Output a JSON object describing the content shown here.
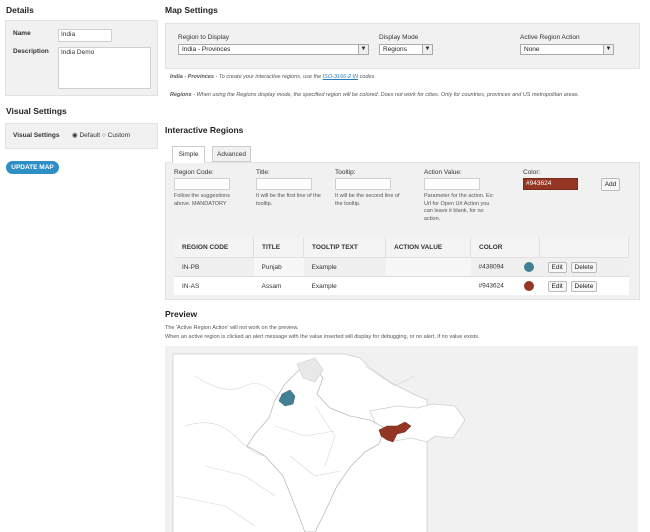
{
  "details": {
    "heading": "Details",
    "name_label": "Name",
    "name_value": "India",
    "description_label": "Description",
    "description_value": "India Demo"
  },
  "visual_settings": {
    "heading": "Visual Settings",
    "label": "Visual Settings",
    "option_default": "Default",
    "option_custom": "Custom"
  },
  "update_button": "UPDATE MAP",
  "map_settings": {
    "heading": "Map Settings",
    "region_label": "Region to Display",
    "region_value": "India - Provinces",
    "display_mode_label": "Display Mode",
    "display_mode_value": "Regions",
    "action_label": "Active Region Action",
    "action_value": "None",
    "note1_bold": "India - Provinces",
    "note1_text": " - To create your interactive regions, use the ",
    "note1_link": "ISO-3166-2:IN",
    "note1_end": " codes.",
    "note2_bold": "Regions",
    "note2_text": " - When using the Regions display mode, the specified region will be colored. Does not work for cities. Only for countries, provinces and US metropolitan areas."
  },
  "interactive_regions": {
    "heading": "Interactive Regions",
    "tabs": [
      "Simple",
      "Advanced"
    ],
    "region_code_label": "Region Code:",
    "region_code_help": "Follow the suggestions above. MANDATORY",
    "title_label": "Title:",
    "title_help": "It will be the first line of the tooltip.",
    "tooltip_label": "Tooltip:",
    "tooltip_help": "It will be the second line of the tooltip.",
    "action_value_label": "Action Value:",
    "action_value_help": "Parameter for the action. Ex: Url for Open Url Action you can leave it blank, for no action.",
    "color_label": "Color:",
    "color_value": "#943624",
    "add_button": "Add",
    "table": {
      "headers": [
        "REGION CODE",
        "TITLE",
        "TOOLTIP TEXT",
        "ACTION VALUE",
        "COLOR"
      ],
      "rows": [
        {
          "code": "IN-PB",
          "title": "Punjab",
          "tooltip": "Example",
          "action": "",
          "color": "#438094",
          "edit": "Edit",
          "delete": "Delete"
        },
        {
          "code": "IN-AS",
          "title": "Assam",
          "tooltip": "Example",
          "action": "",
          "color": "#943624",
          "edit": "Edit",
          "delete": "Delete"
        }
      ]
    }
  },
  "preview": {
    "heading": "Preview",
    "note1": "The 'Active Region Action' will not work on the preview.",
    "note2": "When an active region is clicked an alert message with the value inserted will display for debugging, or no alert, if no value exists."
  },
  "colors": {
    "punjab": "#438094",
    "assam": "#943624",
    "land": "#f4f4f4",
    "border": "#cfcfcf"
  }
}
